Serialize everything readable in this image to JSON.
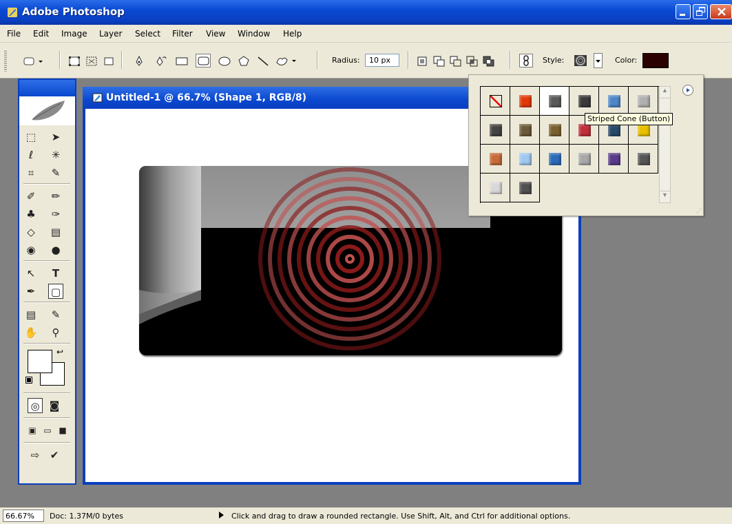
{
  "app": {
    "title": "Adobe Photoshop"
  },
  "menu": [
    "File",
    "Edit",
    "Image",
    "Layer",
    "Select",
    "Filter",
    "View",
    "Window",
    "Help"
  ],
  "options": {
    "radius_label": "Radius:",
    "radius_value": "10 px",
    "style_label": "Style:",
    "color_label": "Color:",
    "color_value": "#2b0000"
  },
  "document": {
    "title": "Untitled-1 @ 66.7% (Shape 1, RGB/8)"
  },
  "style_picker": {
    "tooltip": "Striped Cone (Button)",
    "styles": [
      {
        "name": "none-style",
        "color": "none"
      },
      {
        "name": "red-glow-style",
        "color": "#e23a0b"
      },
      {
        "name": "dark-gray-button-style",
        "color": "#5a5a5a"
      },
      {
        "name": "striped-cone-button-style",
        "color": "#3a3a3a"
      },
      {
        "name": "blue-glass-style",
        "color": "#4d86c8"
      },
      {
        "name": "light-gray-style",
        "color": "#b0b0b0"
      },
      {
        "name": "black-gradient-style",
        "color": "#444444"
      },
      {
        "name": "bronze-style",
        "color": "#6b5a3a"
      },
      {
        "name": "brown-gradient-style",
        "color": "#7a6030"
      },
      {
        "name": "red-stripes-style",
        "color": "#c0303a"
      },
      {
        "name": "multicolor-style",
        "color": "#2a4a6a"
      },
      {
        "name": "yellow-gradient-style",
        "color": "#e8c000"
      },
      {
        "name": "sunset-style",
        "color": "#c86a3a"
      },
      {
        "name": "light-blue-style",
        "color": "#9fc8f0"
      },
      {
        "name": "horizon-style",
        "color": "#2a6ab8"
      },
      {
        "name": "silver-pattern-style",
        "color": "#a8a8a8"
      },
      {
        "name": "purple-bevel-style",
        "color": "#5a3a8a"
      },
      {
        "name": "charcoal-style",
        "color": "#555555"
      },
      {
        "name": "outline-gray-style",
        "color": "#d8d8d8"
      },
      {
        "name": "graphite-style",
        "color": "#505050"
      }
    ]
  },
  "status": {
    "zoom": "66.67%",
    "doc_info": "Doc: 1.37M/0 bytes",
    "message": "Click and drag to draw a rounded rectangle. Use Shift, Alt, and Ctrl for additional options."
  }
}
